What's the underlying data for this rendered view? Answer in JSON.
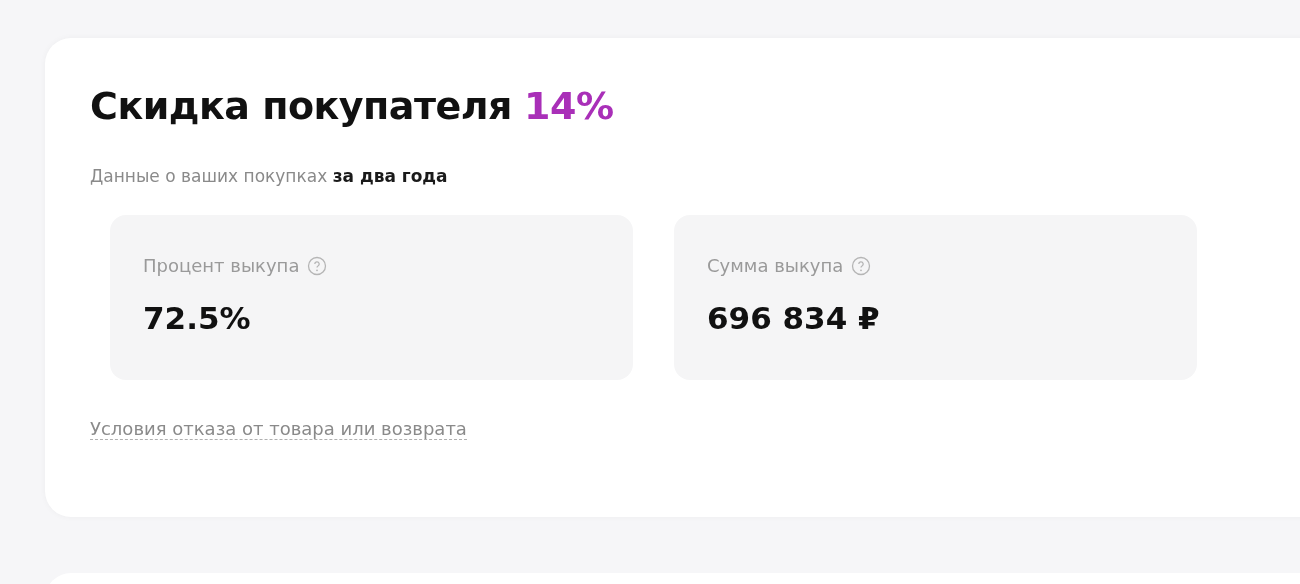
{
  "card": {
    "title": "Скидка покупателя",
    "discount": "14%",
    "subtitle": "Данные о ваших покупках **за два года**",
    "stats": [
      {
        "label": "Процент выкупа",
        "value": "72.5%"
      },
      {
        "label": "Сумма выкупа",
        "value": "696 834 ₽"
      }
    ],
    "link": "Условия отказа от товара или возврата"
  }
}
